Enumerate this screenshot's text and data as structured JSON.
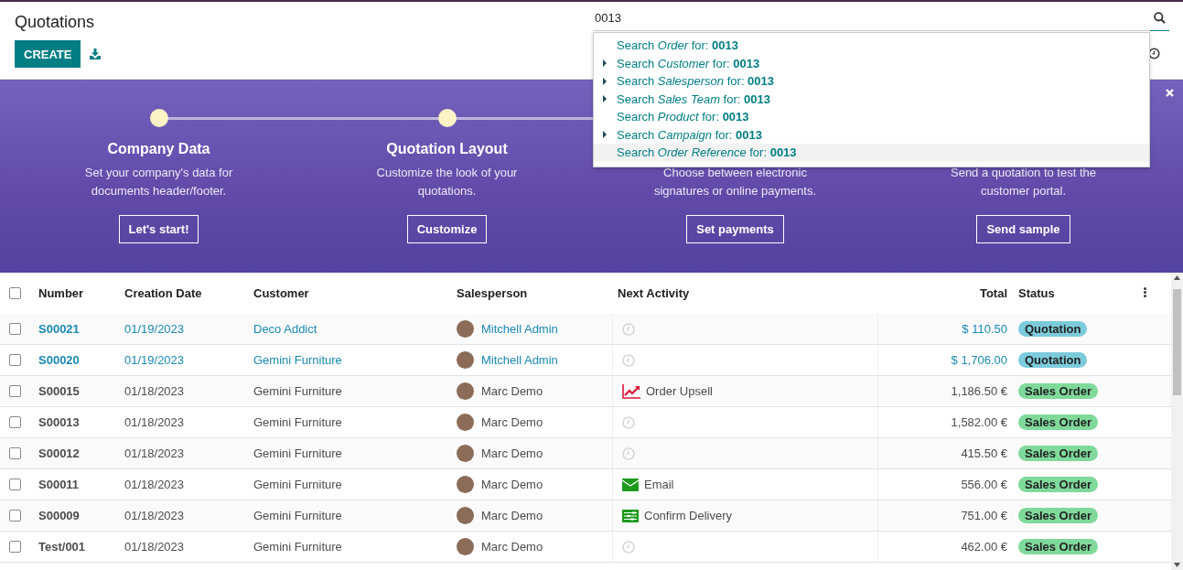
{
  "header": {
    "title": "Quotations",
    "create_button": "CREATE",
    "search_value": "0013"
  },
  "search_suggestions": [
    {
      "text": "Search *Order* for: **0013**",
      "expandable": false,
      "selected": false
    },
    {
      "text": "Search *Customer* for: **0013**",
      "expandable": true,
      "selected": false
    },
    {
      "text": "Search *Salesperson* for: **0013**",
      "expandable": true,
      "selected": false
    },
    {
      "text": "Search *Sales Team* for: **0013**",
      "expandable": true,
      "selected": false
    },
    {
      "text": "Search *Product* for: **0013**",
      "expandable": false,
      "selected": false
    },
    {
      "text": "Search *Campaign* for: **0013**",
      "expandable": true,
      "selected": false
    },
    {
      "text": "Search *Order Reference* for: **0013**",
      "expandable": false,
      "selected": true
    }
  ],
  "onboarding": {
    "steps": [
      {
        "title": "Company Data",
        "description": "Set your company's data for documents header/footer.",
        "button": "Let's start!"
      },
      {
        "title": "Quotation Layout",
        "description": "Customize the look of your quotations.",
        "button": "Customize"
      },
      {
        "description": "Choose between electronic signatures or online payments.",
        "button": "Set payments"
      },
      {
        "description": "Send a quotation to test the customer portal.",
        "button": "Send sample"
      }
    ]
  },
  "table": {
    "select_all_checked": false,
    "columns": [
      "Number",
      "Creation Date",
      "Customer",
      "Salesperson",
      "Next Activity",
      "Total",
      "Status"
    ],
    "rows": [
      {
        "checked": false,
        "highlighted": true,
        "number": "S00021",
        "date": "01/19/2023",
        "customer": "Deco Addict",
        "salesperson": "Mitchell Admin",
        "activity": {
          "kind": "none"
        },
        "total": "$ 110.50",
        "status": {
          "label": "Quotation",
          "color": "#7ccbdc"
        }
      },
      {
        "checked": false,
        "highlighted": true,
        "number": "S00020",
        "date": "01/19/2023",
        "customer": "Gemini Furniture",
        "salesperson": "Mitchell Admin",
        "activity": {
          "kind": "none"
        },
        "total": "$ 1,706.00",
        "status": {
          "label": "Quotation",
          "color": "#7ccbdc"
        }
      },
      {
        "checked": false,
        "highlighted": false,
        "number": "S00015",
        "date": "01/18/2023",
        "customer": "Gemini Furniture",
        "salesperson": "Marc Demo",
        "activity": {
          "kind": "upsell",
          "label": "Order Upsell"
        },
        "total": "1,186.50 €",
        "status": {
          "label": "Sales Order",
          "color": "#7fd99a"
        }
      },
      {
        "checked": false,
        "highlighted": false,
        "number": "S00013",
        "date": "01/18/2023",
        "customer": "Gemini Furniture",
        "salesperson": "Marc Demo",
        "activity": {
          "kind": "none"
        },
        "total": "1,582.00 €",
        "status": {
          "label": "Sales Order",
          "color": "#7fd99a"
        }
      },
      {
        "checked": false,
        "highlighted": false,
        "number": "S00012",
        "date": "01/18/2023",
        "customer": "Gemini Furniture",
        "salesperson": "Marc Demo",
        "activity": {
          "kind": "none"
        },
        "total": "415.50 €",
        "status": {
          "label": "Sales Order",
          "color": "#7fd99a"
        }
      },
      {
        "checked": false,
        "highlighted": false,
        "number": "S00011",
        "date": "01/18/2023",
        "customer": "Gemini Furniture",
        "salesperson": "Marc Demo",
        "activity": {
          "kind": "email",
          "label": "Email"
        },
        "total": "556.00 €",
        "status": {
          "label": "Sales Order",
          "color": "#7fd99a"
        }
      },
      {
        "checked": false,
        "highlighted": false,
        "number": "S00009",
        "date": "01/18/2023",
        "customer": "Gemini Furniture",
        "salesperson": "Marc Demo",
        "activity": {
          "kind": "delivery",
          "label": "Confirm Delivery"
        },
        "total": "751.00 €",
        "status": {
          "label": "Sales Order",
          "color": "#7fd99a"
        }
      },
      {
        "checked": false,
        "highlighted": false,
        "number": "Test/001",
        "date": "01/18/2023",
        "customer": "Gemini Furniture",
        "salesperson": "Marc Demo",
        "activity": {
          "kind": "none"
        },
        "total": "462.00 €",
        "status": {
          "label": "Sales Order",
          "color": "#7fd99a"
        }
      }
    ]
  }
}
